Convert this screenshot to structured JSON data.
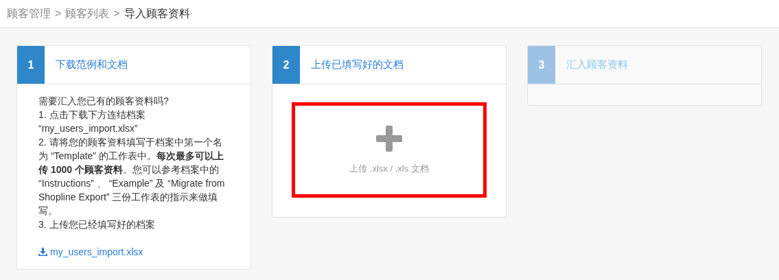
{
  "breadcrumb": [
    {
      "label": "顾客管理",
      "kind": "item",
      "current": false
    },
    {
      "label": ">",
      "kind": "separator"
    },
    {
      "label": "顾客列表",
      "kind": "item",
      "current": false
    },
    {
      "label": ">",
      "kind": "separator"
    },
    {
      "label": "导入顾客资料",
      "kind": "item",
      "current": true
    }
  ],
  "steps": [
    {
      "number": "1",
      "title": "下载范例和文档",
      "disabled": false,
      "kind": "download",
      "lines": [
        "需要汇入您已有的顾客资料吗?",
        "1. 点击下载下方连结档案 “my_users_import.xlsx”",
        "2. 请将您的顾客资料填写于档案中第一个名为 “Template” 的工作表中。**每次最多可以上传 1000 个顾客资料**。您可以参考档案中的 “Instructions” 、 “Example” 及 “Migrate from Shopline Export” 三份工作表的指示来做填写。",
        "3. 上传您已经填写好的档案"
      ],
      "link": "my_users_import.xlsx"
    },
    {
      "number": "2",
      "title": "上传已填写好的文档",
      "disabled": false,
      "kind": "upload",
      "upload_label": "上传 .xlsx / .xls 文档"
    },
    {
      "number": "3",
      "title": "汇入顾客资料",
      "disabled": true,
      "kind": "empty"
    }
  ]
}
